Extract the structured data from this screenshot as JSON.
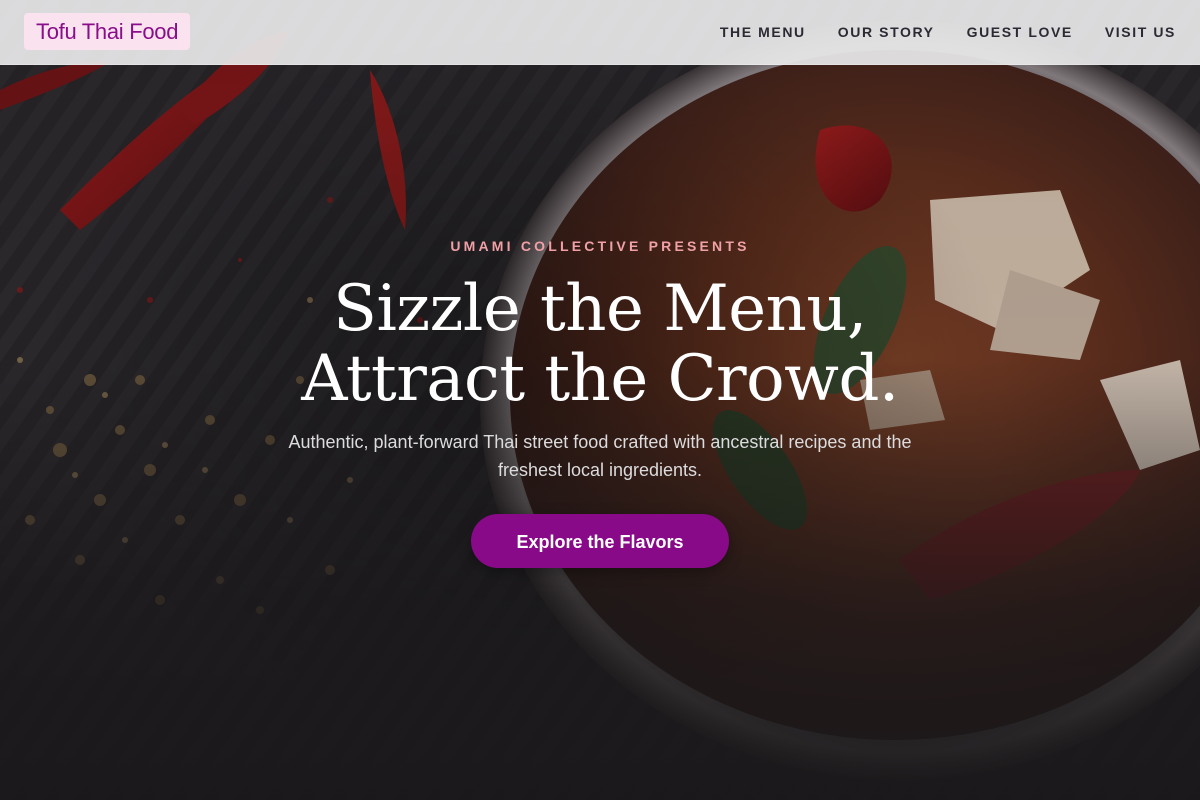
{
  "brand": {
    "name": "Tofu Thai Food",
    "badge_color": "#fbe2ef",
    "text_color": "#8a0e8a"
  },
  "nav": {
    "items": [
      {
        "label": "THE MENU"
      },
      {
        "label": "OUR STORY"
      },
      {
        "label": "GUEST LOVE"
      },
      {
        "label": "VISIT US"
      }
    ]
  },
  "hero": {
    "eyebrow": "UMAMI COLLECTIVE PRESENTS",
    "headline_line1": "Sizzle the Menu,",
    "headline_line2": "Attract the Crowd.",
    "subtext": "Authentic, plant-forward Thai street food crafted with ancestral recipes and the freshest local ingredients.",
    "cta_label": "Explore the Flavors",
    "background": "curry-bowl-with-chilies-photo"
  },
  "colors": {
    "accent": "#880a88",
    "eyebrow": "#f0a0a6",
    "navbar": "#e8e8ea"
  }
}
